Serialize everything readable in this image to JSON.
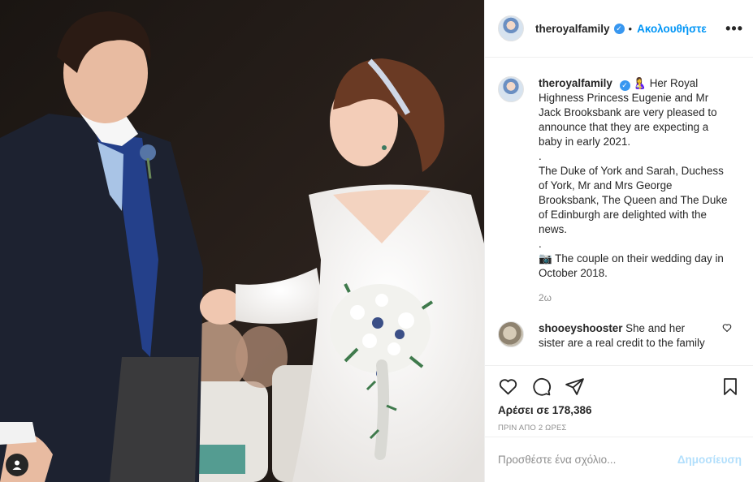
{
  "header": {
    "username": "theroyalfamily",
    "separator": "•",
    "follow_label": "Ακολουθήστε",
    "more_label": "•••"
  },
  "caption": {
    "username": "theroyalfamily",
    "emoji": "🤱",
    "para1": "Her Royal Highness Princess Eugenie and Mr Jack Brooksbank are very pleased to announce that they are expecting a baby in early 2021.",
    "dot1": ".",
    "para2": "The Duke of York and Sarah, Duchess of York, Mr and Mrs George Brooksbank, The Queen and The Duke of Edinburgh are delighted with the news.",
    "dot2": ".",
    "camera": "📷",
    "para3": "The couple on their wedding day in October 2018.",
    "time_ago": "2ω"
  },
  "comment": {
    "username": "shooeyshooster",
    "text": "She and her sister are a real credit to the family"
  },
  "stats": {
    "likes": "Αρέσει σε 178,386",
    "posted": "ΠΡΙΝ ΑΠΟ 2 ΩΡΕΣ"
  },
  "add_comment": {
    "placeholder": "Προσθέστε ένα σχόλιο...",
    "post_label": "Δημοσίευση"
  },
  "icons": {
    "verified": "verified-badge-icon",
    "heart": "heart-icon",
    "comment": "comment-icon",
    "share": "paper-plane-icon",
    "bookmark": "bookmark-icon",
    "user_tag": "user-icon"
  },
  "colors": {
    "accent": "#0095f6",
    "verified": "#3897f0",
    "muted": "#8e8e8e",
    "post_disabled": "#b2dffc"
  }
}
